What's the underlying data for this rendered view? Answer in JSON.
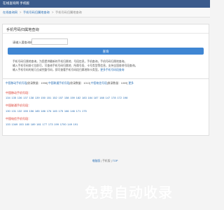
{
  "header": {
    "site_title": "在线查询网 手机版"
  },
  "breadcrumb": {
    "home": "在线查询网",
    "section": "手机号码归属地查询",
    "current": "手机号码归属地查询",
    "sep": ">"
  },
  "query_panel": {
    "title": "手机号码归属地查询",
    "field_label": "请输入要查询的手机号码：",
    "input_value": "",
    "button_label": "查询"
  },
  "info": {
    "line1": "手机号码归属地查询，为您提供最新的手机归属地、号段信息，手机查询，手机号码归属地查询。",
    "line2": "输入手机号码前七位即可，可查询手机号码归属地、所属号段、卡号类型等信息，支持全国各地号段查询。",
    "line3": "输入手机号码的前几位或完整号码，即可查看手机号码段归属地和卡类型。",
    "line3_link": "更多手机号码段查询"
  },
  "stats": {
    "mobile_label": "中国移动手机号段",
    "mobile_count": "[收录数量：1998]",
    "unicom_label": "中国联通手机号段",
    "unicom_count": "[收录数量：1013]",
    "telecom_label": "中国电信号段",
    "telecom_count": "[收录数量：1009]",
    "more": "更多"
  },
  "carriers": [
    {
      "title": "中国移动手机号段：",
      "prefixes": "134 135 136 137 138 139 150 151 152 157 158 159 182 183 184 187 188 147 178 172 198"
    },
    {
      "title": "中国联通手机号段：",
      "prefixes": "130 131 132 155 156 185 186 176 145 175 166 146 171 175"
    },
    {
      "title": "中国电信手机号段：",
      "prefixes": "133 1349 153 180 189 181 177 173 199 1700 149 191"
    }
  ],
  "footer": {
    "link1": "电脑版",
    "sep1": "|",
    "middle": "手机版",
    "sep2": "|",
    "link2": "TOP"
  },
  "watermark": "免费自动收录"
}
